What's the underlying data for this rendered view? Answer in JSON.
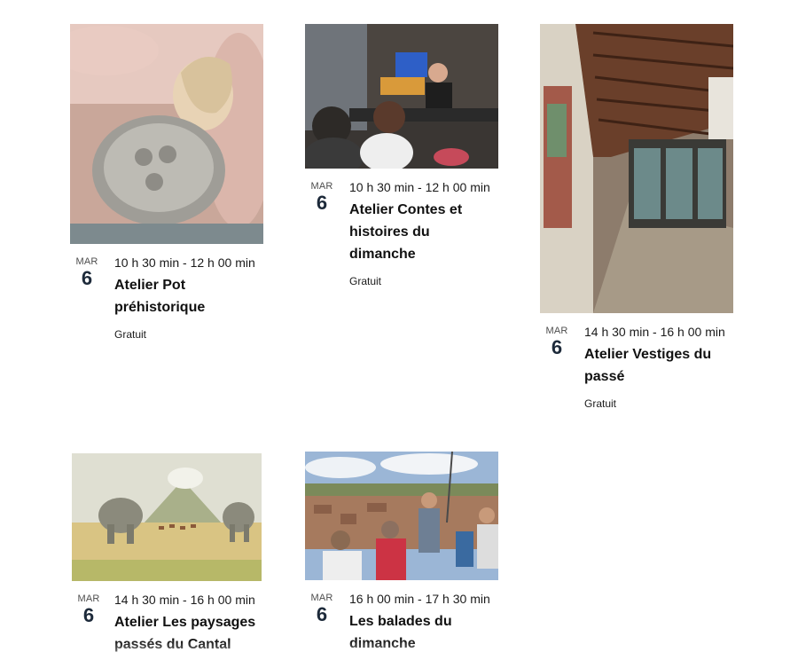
{
  "events": [
    {
      "image_alt": "Hands shaping a clay pot with shell imprints",
      "dow": "MAR",
      "day": "6",
      "time": "10 h 30 min - 12 h 00 min",
      "title_line1": "Atelier Pot",
      "title_line2": "préhistorique",
      "price": "Gratuit"
    },
    {
      "image_alt": "Storyteller with children during a story session",
      "dow": "MAR",
      "day": "6",
      "time": "10 h 30 min - 12 h 00 min",
      "title_line1": "Atelier Contes et",
      "title_line2": "histoires du dimanche",
      "price": "Gratuit"
    },
    {
      "image_alt": "Museum gallery with wooden beamed ceiling and glass display cases",
      "dow": "MAR",
      "day": "6",
      "time": "14 h 30 min - 16 h 00 min",
      "title_line1": "Atelier Vestiges du",
      "title_line2": "passé",
      "price": "Gratuit"
    },
    {
      "image_alt": "Illustration of mammoths in a prehistoric landscape with a volcano",
      "dow": "MAR",
      "day": "6",
      "time": "14 h 30 min - 16 h 00 min",
      "title_line1": "Atelier Les paysages",
      "title_line2": "passés du Cantal",
      "price": ""
    },
    {
      "image_alt": "Guide showing a town view to a group of visitors",
      "dow": "MAR",
      "day": "6",
      "time": "16 h 00 min - 17 h 30 min",
      "title_line1": "Les balades du",
      "title_line2": "dimanche",
      "price": ""
    }
  ]
}
